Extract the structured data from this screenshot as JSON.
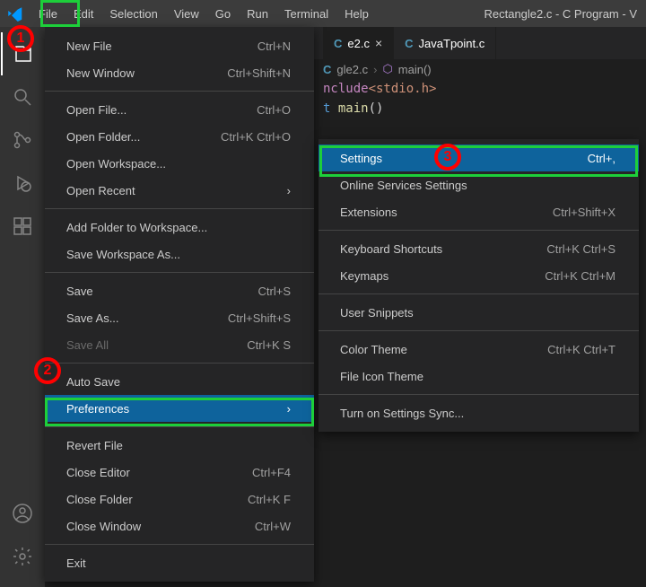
{
  "window": {
    "title": "Rectangle2.c - C Program - V"
  },
  "menubar": {
    "items": [
      "File",
      "Edit",
      "Selection",
      "View",
      "Go",
      "Run",
      "Terminal",
      "Help"
    ]
  },
  "tabs": [
    {
      "icon": "C",
      "label": "e2.c",
      "close": "×",
      "active": true
    },
    {
      "icon": "C",
      "label": "JavaTpoint.c",
      "close": "",
      "active": false
    }
  ],
  "breadcrumb": {
    "file": "gle2.c",
    "symbol": "main()"
  },
  "code": {
    "line1_kw": "nclude",
    "line1_inc": "<stdio.h>",
    "line2_kw": "t ",
    "line2_fn": "main",
    "line2_tail": "()"
  },
  "file_menu": {
    "groups": [
      [
        {
          "label": "New File",
          "shortcut": "Ctrl+N"
        },
        {
          "label": "New Window",
          "shortcut": "Ctrl+Shift+N"
        }
      ],
      [
        {
          "label": "Open File...",
          "shortcut": "Ctrl+O"
        },
        {
          "label": "Open Folder...",
          "shortcut": "Ctrl+K Ctrl+O"
        },
        {
          "label": "Open Workspace...",
          "shortcut": ""
        },
        {
          "label": "Open Recent",
          "shortcut": "",
          "submenu": true
        }
      ],
      [
        {
          "label": "Add Folder to Workspace...",
          "shortcut": ""
        },
        {
          "label": "Save Workspace As...",
          "shortcut": ""
        }
      ],
      [
        {
          "label": "Save",
          "shortcut": "Ctrl+S"
        },
        {
          "label": "Save As...",
          "shortcut": "Ctrl+Shift+S"
        },
        {
          "label": "Save All",
          "shortcut": "Ctrl+K S",
          "disabled": true
        }
      ],
      [
        {
          "label": "Auto Save",
          "shortcut": ""
        },
        {
          "label": "Preferences",
          "shortcut": "",
          "submenu": true,
          "highlight": true
        }
      ],
      [
        {
          "label": "Revert File",
          "shortcut": ""
        },
        {
          "label": "Close Editor",
          "shortcut": "Ctrl+F4"
        },
        {
          "label": "Close Folder",
          "shortcut": "Ctrl+K F"
        },
        {
          "label": "Close Window",
          "shortcut": "Ctrl+W"
        }
      ],
      [
        {
          "label": "Exit",
          "shortcut": ""
        }
      ]
    ]
  },
  "sub_menu": {
    "groups": [
      [
        {
          "label": "Settings",
          "shortcut": "Ctrl+,",
          "highlight": true
        },
        {
          "label": "Online Services Settings",
          "shortcut": ""
        },
        {
          "label": "Extensions",
          "shortcut": "Ctrl+Shift+X"
        }
      ],
      [
        {
          "label": "Keyboard Shortcuts",
          "shortcut": "Ctrl+K Ctrl+S"
        },
        {
          "label": "Keymaps",
          "shortcut": "Ctrl+K Ctrl+M"
        }
      ],
      [
        {
          "label": "User Snippets",
          "shortcut": ""
        }
      ],
      [
        {
          "label": "Color Theme",
          "shortcut": "Ctrl+K Ctrl+T"
        },
        {
          "label": "File Icon Theme",
          "shortcut": ""
        }
      ],
      [
        {
          "label": "Turn on Settings Sync...",
          "shortcut": ""
        }
      ]
    ]
  },
  "annotations": {
    "c1": "1",
    "c2": "2",
    "c3": "3"
  }
}
